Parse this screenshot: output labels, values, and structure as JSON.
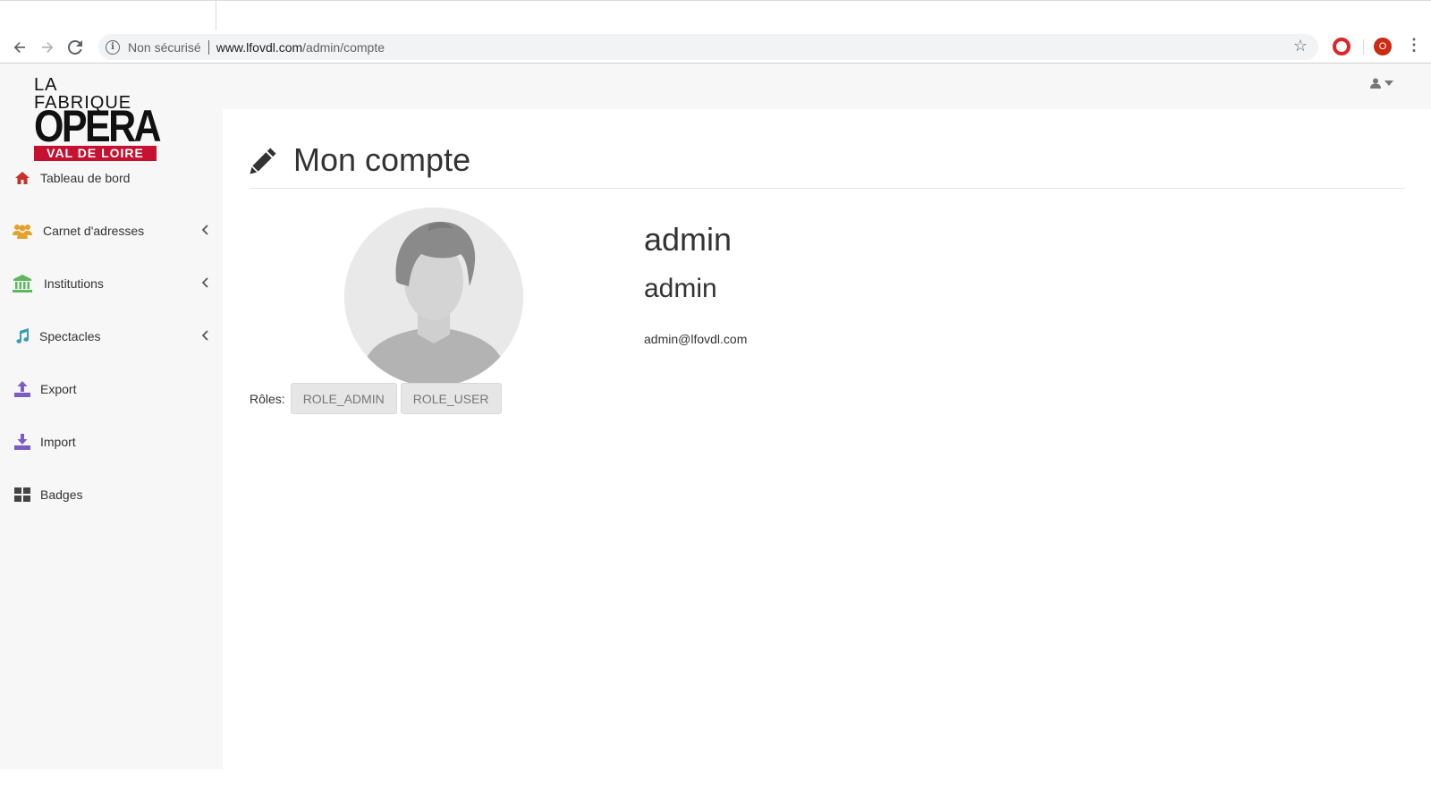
{
  "browser": {
    "insecure_label": "Non sécurisé",
    "url_host": "www.lfovdl.com",
    "url_path": "/admin/compte",
    "profile_initial": "O"
  },
  "logo": {
    "line1": "LA FABRIQUE",
    "line2": "OPERA",
    "line3": "VAL DE LOIRE"
  },
  "sidebar": {
    "items": [
      {
        "label": "Tableau de bord",
        "icon": "home-icon",
        "color": "#c9302c"
      },
      {
        "label": "Carnet d'adresses",
        "icon": "users-icon",
        "color": "#e6a12d"
      },
      {
        "label": "Institutions",
        "icon": "institution-icon",
        "color": "#5cb85c"
      },
      {
        "label": "Spectacles",
        "icon": "music-icon",
        "color": "#3a9bb4"
      },
      {
        "label": "Export",
        "icon": "upload-icon",
        "color": "#7c5cc4"
      },
      {
        "label": "Import",
        "icon": "download-icon",
        "color": "#7c5cc4"
      },
      {
        "label": "Badges",
        "icon": "grid-icon",
        "color": "#444444"
      }
    ]
  },
  "page": {
    "title": "Mon compte",
    "username": "admin",
    "fullname": "admin",
    "email": "admin@lfovdl.com",
    "roles_label": "Rôles:",
    "roles": [
      "ROLE_ADMIN",
      "ROLE_USER"
    ]
  }
}
